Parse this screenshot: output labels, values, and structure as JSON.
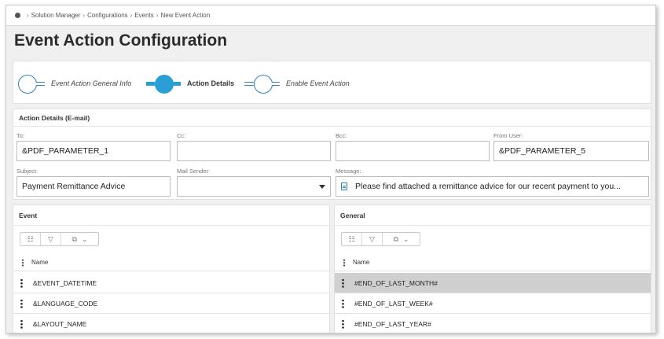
{
  "breadcrumb": {
    "items": [
      "Solution Manager",
      "Configurations",
      "Events",
      "New Event Action"
    ]
  },
  "page": {
    "title": "Event Action Configuration"
  },
  "wizard": {
    "steps": [
      {
        "label": "Event Action General Info",
        "state": "completed"
      },
      {
        "label": "Action Details",
        "state": "active"
      },
      {
        "label": "Enable Event Action",
        "state": "pending"
      }
    ]
  },
  "action_details": {
    "header": "Action Details (E-mail)",
    "fields": {
      "to": {
        "label": "To:",
        "value": "&PDF_PARAMETER_1"
      },
      "cc": {
        "label": "Cc:",
        "value": ""
      },
      "bcc": {
        "label": "Bcc:",
        "value": ""
      },
      "from_user": {
        "label": "From User:",
        "value": "&PDF_PARAMETER_5"
      },
      "subject": {
        "label": "Subject:",
        "value": "Payment Remittance Advice"
      },
      "mail_sender": {
        "label": "Mail Sender:",
        "value": ""
      },
      "message": {
        "label": "Message:",
        "value": "Please find attached a remittance advice for our recent payment to you..."
      }
    }
  },
  "event_panel": {
    "header": "Event",
    "column": "Name",
    "rows": [
      "&EVENT_DATETIME",
      "&LANGUAGE_CODE",
      "&LAYOUT_NAME"
    ]
  },
  "general_panel": {
    "header": "General",
    "column": "Name",
    "rows": [
      "#END_OF_LAST_MONTH#",
      "#END_OF_LAST_WEEK#",
      "#END_OF_LAST_YEAR#"
    ],
    "selected_index": 0
  },
  "toolbar": {
    "icons": [
      "column-list-icon",
      "filter-icon",
      "export-icon"
    ],
    "list_glyph": "☷",
    "filter_glyph": "▽",
    "export_glyph": "⧉",
    "chevron_glyph": "⌄"
  },
  "colors": {
    "accent": "#2a9fd6",
    "accent_border": "#2d7fb8",
    "selected_row": "#cfcfcf",
    "page_bg": "#f0f0f0"
  }
}
